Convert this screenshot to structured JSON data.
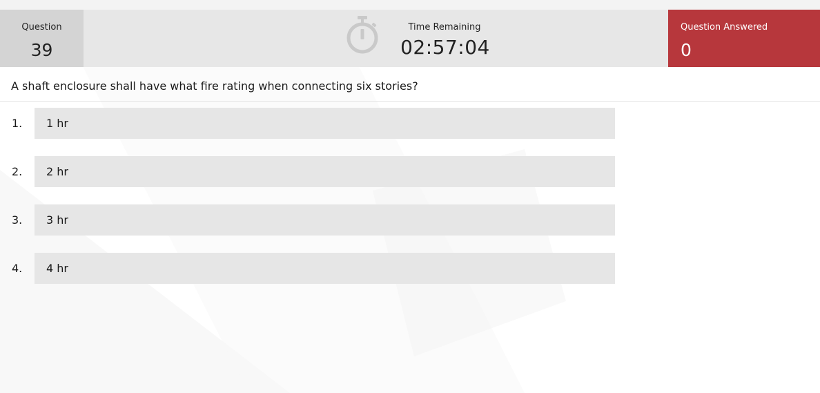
{
  "header": {
    "question_label": "Question",
    "question_number": "39",
    "time_label": "Time Remaining",
    "time_value": "02:57:04",
    "answered_label": "Question Answered",
    "answered_value": "0",
    "timer_icon": "stopwatch-icon",
    "answered_color": "#b7373c"
  },
  "question": {
    "text": "A shaft enclosure shall have what fire rating when connecting six stories?"
  },
  "options": [
    {
      "number": "1.",
      "label": "1 hr"
    },
    {
      "number": "2.",
      "label": "2 hr"
    },
    {
      "number": "3.",
      "label": "3 hr"
    },
    {
      "number": "4.",
      "label": "4 hr"
    }
  ]
}
